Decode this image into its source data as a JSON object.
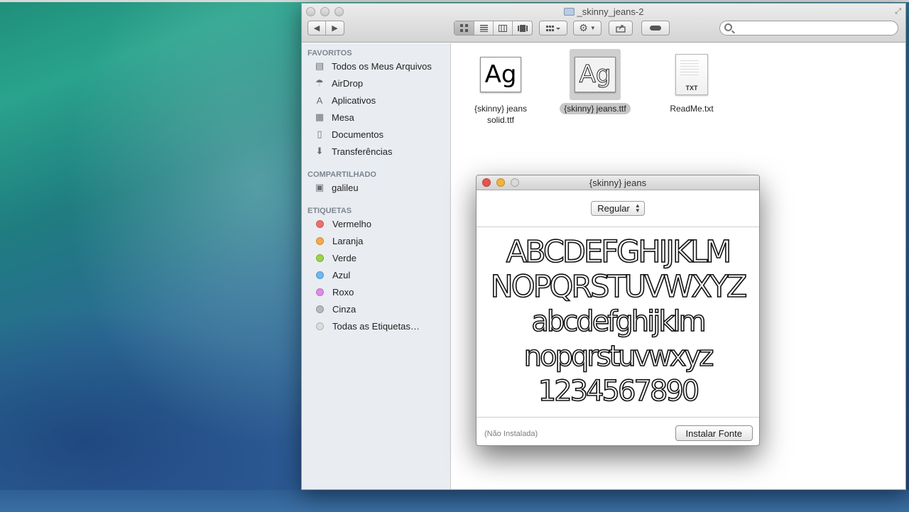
{
  "finder": {
    "title": "_skinny_jeans-2",
    "toolbar": {
      "back_icon": "◀",
      "forward_icon": "▶",
      "view_icons": [
        "icon-view",
        "list-view",
        "column-view",
        "coverflow-view"
      ],
      "arrange_icon": "grid-arrange",
      "action_icon": "⚙",
      "share_icon": "share",
      "tag_icon": "tag"
    },
    "search": {
      "placeholder": ""
    },
    "sidebar": {
      "favorites_header": "FAVORITOS",
      "favorites": [
        {
          "label": "Todos os Meus Arquivos",
          "icon": "▤"
        },
        {
          "label": "AirDrop",
          "icon": "☂"
        },
        {
          "label": "Aplicativos",
          "icon": "A"
        },
        {
          "label": "Mesa",
          "icon": "▦"
        },
        {
          "label": "Documentos",
          "icon": "▯"
        },
        {
          "label": "Transferências",
          "icon": "⬇"
        }
      ],
      "shared_header": "COMPARTILHADO",
      "shared": [
        {
          "label": "galileu",
          "icon": "▣"
        }
      ],
      "tags_header": "ETIQUETAS",
      "tags": [
        {
          "label": "Vermelho",
          "color": "#f26e6e"
        },
        {
          "label": "Laranja",
          "color": "#f7a94a"
        },
        {
          "label": "Verde",
          "color": "#9bd34a"
        },
        {
          "label": "Azul",
          "color": "#6fb8f0"
        },
        {
          "label": "Roxo",
          "color": "#e08be8"
        },
        {
          "label": "Cinza",
          "color": "#b9b9b9"
        },
        {
          "label": "Todas as Etiquetas…",
          "color": "#dcdcdc"
        }
      ]
    },
    "files": [
      {
        "name_line1": "{skinny} jeans",
        "name_line2": "solid.ttf",
        "thumb": "Ag"
      },
      {
        "name": "{skinny} jeans.ttf",
        "thumb": "Ag"
      },
      {
        "name": "ReadMe.txt",
        "badge": "TXT"
      }
    ]
  },
  "preview": {
    "title": "{skinny} jeans",
    "style_select": "Regular",
    "sample": [
      "ABCDEFGHIJKLM",
      "NOPQRSTUVWXYZ",
      "abcdefghijklm",
      "nopqrstuvwxyz",
      "1234567890"
    ],
    "status": "(Não Instalada)",
    "install_label": "Instalar Fonte"
  },
  "colors": {
    "close": "#e9534f",
    "minimize": "#f4b23c",
    "zoom": "#dadada"
  }
}
